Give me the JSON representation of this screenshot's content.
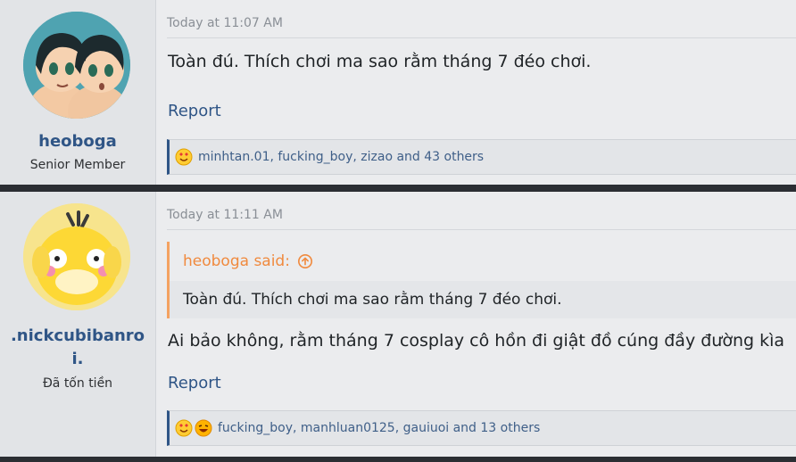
{
  "posts": [
    {
      "username": "heoboga",
      "usertitle": "Senior Member",
      "timestamp": "Today at 11:07 AM",
      "body": "Toàn đú. Thích chơi ma sao rằm tháng 7 đéo chơi.",
      "report_label": "Report",
      "reactions_text": "minhtan.01, fucking_boy, zizao and 43 others"
    },
    {
      "username": ".nickcubibanroi.",
      "usertitle": "Đã tốn tiền",
      "timestamp": "Today at 11:11 AM",
      "quote": {
        "author": "heoboga said:",
        "text": "Toàn đú. Thích chơi ma sao rằm tháng 7 đéo chơi."
      },
      "body": "Ai bảo không, rằm tháng 7 cosplay cô hồn đi giật đồ cúng đầy đường kìa",
      "report_label": "Report",
      "reactions_text": "fucking_boy, manhluan0125, gauiuoi and 13 others"
    }
  ],
  "colors": {
    "accent": "#2f5586",
    "quote_accent": "#f4a261",
    "background": "#ebecee"
  },
  "icons": {
    "reaction_1": "love-emoji-icon",
    "reaction_2": "haha-emoji-icon",
    "quote_jump": "arrow-up-circle-icon"
  }
}
